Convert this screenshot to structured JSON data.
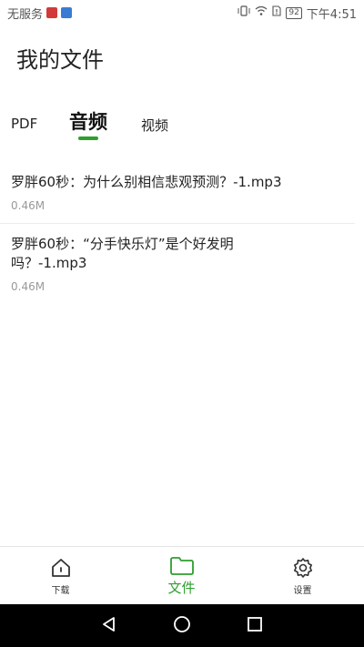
{
  "status_bar": {
    "carrier": "无服务",
    "battery": "92",
    "time": "下午4:51"
  },
  "page": {
    "title": "我的文件"
  },
  "tabs": [
    {
      "label": "PDF",
      "active": false
    },
    {
      "label": "音频",
      "active": true
    },
    {
      "label": "视频",
      "active": false
    }
  ],
  "files": [
    {
      "name": "罗胖60秒：为什么别相信悲观预测？-1.mp3",
      "size": "0.46M"
    },
    {
      "name": "罗胖60秒：“分手快乐灯”是个好发明吗？-1.mp3",
      "size": "0.46M"
    }
  ],
  "bottom_nav": {
    "download": {
      "label": "下载",
      "icon": "home-icon"
    },
    "files": {
      "label": "文件",
      "icon": "folder-icon",
      "active": true
    },
    "settings": {
      "label": "设置",
      "icon": "gear-icon"
    }
  },
  "colors": {
    "accent": "#2e9f2e",
    "text": "#222222",
    "muted": "#999999"
  }
}
